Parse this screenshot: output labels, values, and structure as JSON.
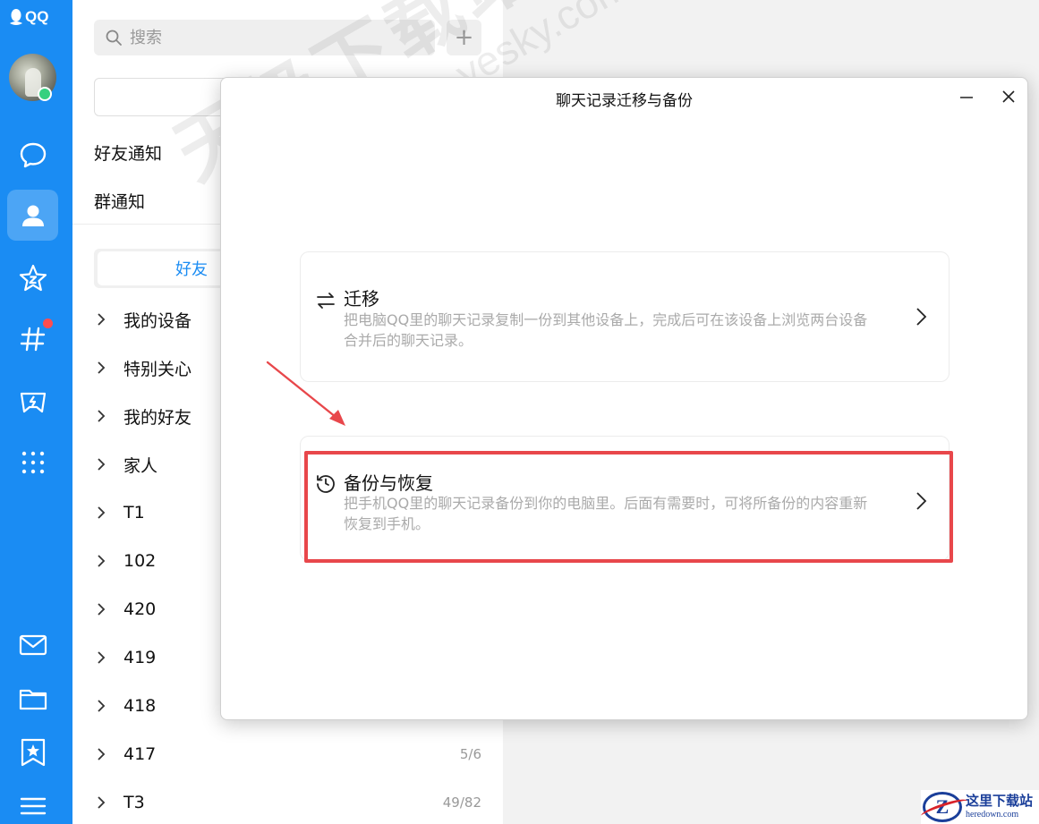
{
  "app": {
    "brand": "QQ"
  },
  "sidebar": {
    "nav": [
      {
        "name": "chat",
        "icon": "chat-bubble-icon"
      },
      {
        "name": "contacts",
        "icon": "contacts-icon",
        "active": true
      },
      {
        "name": "zone",
        "icon": "star-icon"
      },
      {
        "name": "channels",
        "icon": "hashtag-icon",
        "badge_dot": true
      },
      {
        "name": "games",
        "icon": "game-controller-icon"
      },
      {
        "name": "apps",
        "icon": "apps-grid-icon"
      },
      {
        "name": "mail",
        "icon": "mail-icon"
      },
      {
        "name": "files",
        "icon": "folder-icon"
      },
      {
        "name": "favorites",
        "icon": "bookmark-star-icon"
      },
      {
        "name": "menu",
        "icon": "hamburger-menu-icon"
      }
    ]
  },
  "contacts": {
    "search_placeholder": "搜索",
    "add_button": "+",
    "friend_notice": "好友通知",
    "group_notice": "群通知",
    "tab_friends": "好友",
    "groups": [
      {
        "label": "我的设备",
        "count": ""
      },
      {
        "label": "特别关心",
        "count": ""
      },
      {
        "label": "我的好友",
        "count": ""
      },
      {
        "label": "家人",
        "count": ""
      },
      {
        "label": "T1",
        "count": ""
      },
      {
        "label": "102",
        "count": ""
      },
      {
        "label": "420",
        "count": ""
      },
      {
        "label": "419",
        "count": ""
      },
      {
        "label": "418",
        "count": ""
      },
      {
        "label": "417",
        "count": "5/6"
      },
      {
        "label": "T3",
        "count": "49/82"
      }
    ]
  },
  "dialog": {
    "title": "聊天记录迁移与备份",
    "migrate": {
      "title": "迁移",
      "desc": "把电脑QQ里的聊天记录复制一份到其他设备上，完成后可在该设备上浏览两台设备合并后的聊天记录。"
    },
    "backup": {
      "title": "备份与恢复",
      "desc": "把手机QQ里的聊天记录备份到你的电脑里。后面有需要时，可将所备份的内容重新恢复到手机。"
    }
  },
  "watermark": {
    "line1": "天极下载站",
    "line2": "mydown.yesky.com"
  },
  "corner_logo": {
    "mark": "Z",
    "name": "这里下载站",
    "url": "heredown.com"
  },
  "colors": {
    "brand_blue": "#1a8cf3",
    "highlight_red": "#e8474b",
    "online_green": "#35d07f",
    "badge_red": "#ff4d4f"
  }
}
